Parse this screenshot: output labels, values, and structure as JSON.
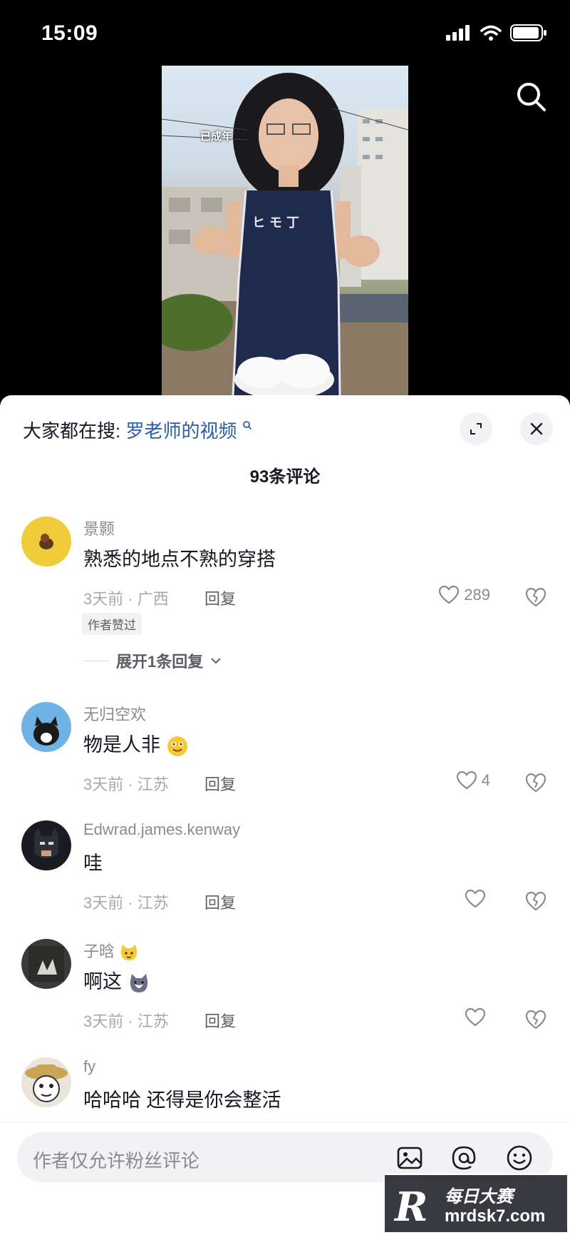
{
  "status_bar": {
    "time": "15:09"
  },
  "video": {
    "overlay_text": "已成年",
    "shirt_text": "ヒモ丁"
  },
  "header": {
    "hot_search_label": "大家都在搜:",
    "hot_search_keyword": "罗老师的视频",
    "comment_count_title": "93条评论"
  },
  "comments": [
    {
      "name": "景颢",
      "text": "熟悉的地点不熟的穿搭",
      "meta": "3天前 · 广西",
      "reply": "回复",
      "likes": "289",
      "badge": "作者赞过",
      "expand": "展开1条回复"
    },
    {
      "name": "无归空欢",
      "text": "物是人非",
      "meta": "3天前 · 江苏",
      "reply": "回复",
      "likes": "4"
    },
    {
      "name": "Edwrad.james.kenway",
      "text": "哇",
      "meta": "3天前 · 江苏",
      "reply": "回复",
      "likes": ""
    },
    {
      "name": "子晗",
      "text": "啊这",
      "meta": "3天前 · 江苏",
      "reply": "回复",
      "likes": ""
    },
    {
      "name": "fy",
      "text": "哈哈哈 还得是你会整活"
    }
  ],
  "input": {
    "placeholder": "作者仅允许粉丝评论"
  },
  "watermark": {
    "logo": "R",
    "cn": "每日大赛",
    "en": "mrdsk7.com"
  },
  "colors": {
    "keyword_blue": "#2a5caa",
    "text_primary": "#161823",
    "text_secondary": "#8a8b91"
  }
}
